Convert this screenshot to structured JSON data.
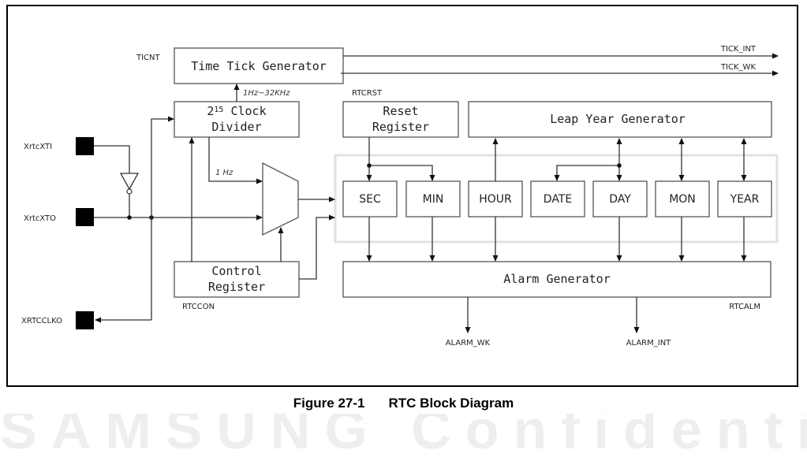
{
  "figure": {
    "number": "Figure 27-1",
    "title": "RTC Block Diagram",
    "watermark": "SAMSUNG Confidential"
  },
  "blocks": {
    "time_tick_generator": "Time Tick Generator",
    "clock_divider_base": "2",
    "clock_divider_exp": "15",
    "clock_divider_line1": " Clock",
    "clock_divider_line2": "Divider",
    "reset_register_line1": "Reset",
    "reset_register_line2": "Register",
    "leap_year_generator": "Leap Year Generator",
    "control_register_line1": "Control",
    "control_register_line2": "Register",
    "alarm_generator": "Alarm Generator",
    "counters": [
      "SEC",
      "MIN",
      "HOUR",
      "DATE",
      "DAY",
      "MON",
      "YEAR"
    ]
  },
  "register_labels": {
    "ticnt": "TICNT",
    "rtcrst": "RTCRST",
    "rtccon": "RTCCON",
    "rtcalm": "RTCALM"
  },
  "pins": {
    "xtal_in": "XrtcXTI",
    "xtal_out": "XrtcXTO",
    "clk_out": "XRTCCLKO"
  },
  "signals": {
    "tick_int": "TICK_INT",
    "tick_wk": "TICK_WK",
    "alarm_wk": "ALARM_WK",
    "alarm_int": "ALARM_INT",
    "freq_range": "1Hz~32KHz",
    "one_hz": "1 Hz"
  }
}
